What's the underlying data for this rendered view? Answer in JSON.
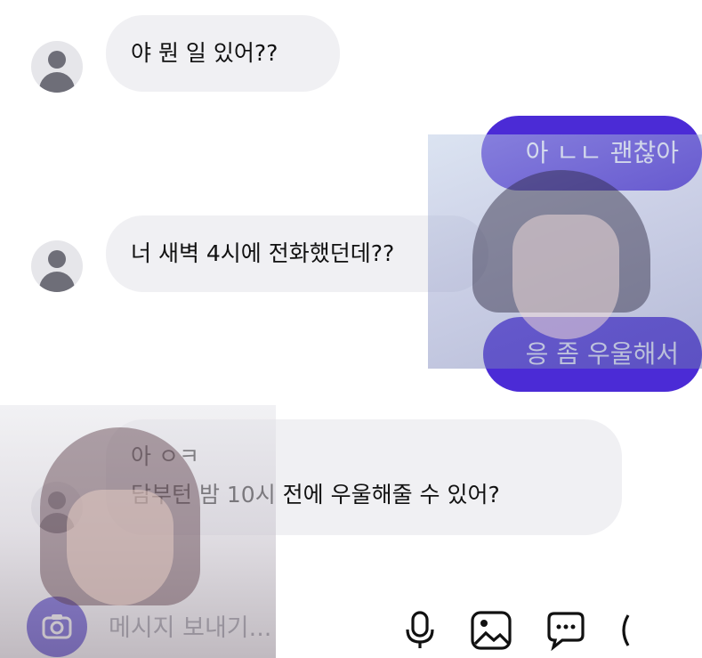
{
  "messages": [
    {
      "side": "in",
      "lines": [
        "야 뭔 일 있어??"
      ]
    },
    {
      "side": "out",
      "lines": [
        "아 ㄴㄴ 괜찮아"
      ]
    },
    {
      "side": "in",
      "lines": [
        "너 새벽 4시에 전화했던데??"
      ]
    },
    {
      "side": "out",
      "lines": [
        "응 좀 우울해서"
      ]
    },
    {
      "side": "in",
      "lines": [
        "아 ㅇㅋ",
        "담부턴 밤 10시 전에 우울해줄 수 있어?"
      ]
    }
  ],
  "composer": {
    "placeholder": "메시지 보내기...",
    "icons": [
      "camera-icon",
      "microphone-icon",
      "image-icon",
      "chat-bubble-icon",
      "more-icon"
    ]
  },
  "colors": {
    "accent": "#4b2bd6",
    "incoming_bubble": "#f0f0f3",
    "avatar_glyph": "#6e6e78"
  }
}
